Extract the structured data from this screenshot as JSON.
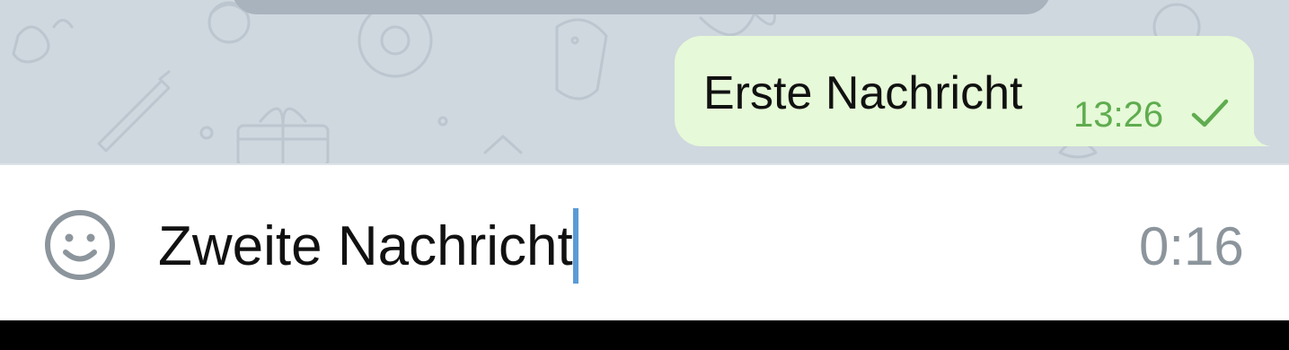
{
  "chat": {
    "background_color": "#cfd7df",
    "messages": [
      {
        "text": "Erste Nachricht",
        "time": "13:26",
        "status_icon": "check-icon",
        "bubble_color": "#e6f9d8",
        "time_color": "#5fac4f"
      }
    ]
  },
  "input_bar": {
    "emoji_icon": "emoji-icon",
    "value": "Zweite Nachricht",
    "caret_color": "#5b9bd5",
    "recording_time": "0:16"
  }
}
